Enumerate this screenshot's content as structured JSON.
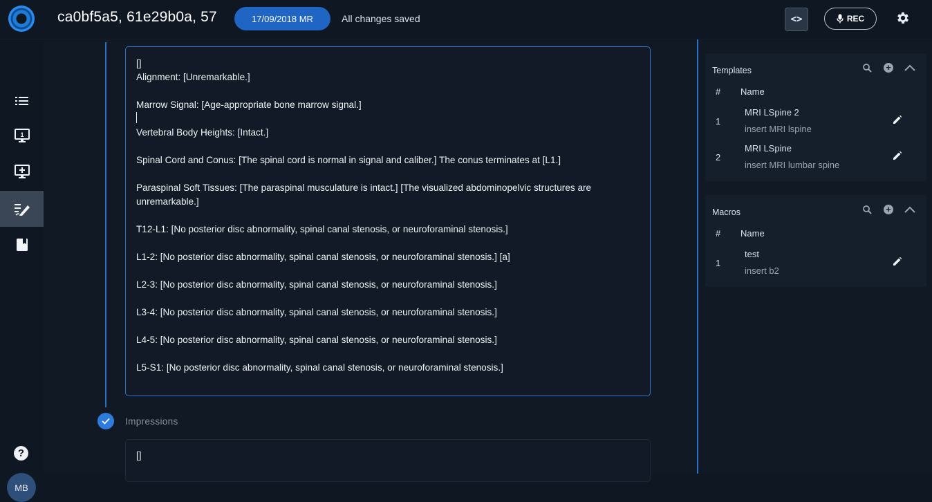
{
  "header": {
    "title": "ca0bf5a5, 61e29b0a, 57",
    "date_badge": "17/09/2018 MR",
    "save_status": "All changes saved",
    "code_toggle": "<>",
    "rec_label": "REC"
  },
  "sidebar": {
    "items": [
      {
        "icon": "list-icon"
      },
      {
        "icon": "monitor-one-icon",
        "badge": "1"
      },
      {
        "icon": "monitor-add-icon"
      },
      {
        "icon": "edit-report-icon",
        "active": true
      },
      {
        "icon": "book-icon"
      }
    ],
    "help": "?",
    "avatar_initials": "MB"
  },
  "editor": {
    "findings_text": "[]\nAlignment: [Unremarkable.]\n\nMarrow Signal: [Age-appropriate bone marrow signal.]\n\nVertebral Body Heights: [Intact.]\n\nSpinal Cord and Conus: [The spinal cord is normal in signal and caliber.] The conus terminates at [L1.]\n\nParaspinal Soft Tissues: [The paraspinal musculature is intact.] [The visualized abdominopelvic structures are unremarkable.]\n\nT12-L1: [No posterior disc abnormality, spinal canal stenosis, or neuroforaminal stenosis.]\n\nL1-2: [No posterior disc abnormality, spinal canal stenosis, or neuroforaminal stenosis.] [a]\n\nL2-3: [No posterior disc abnormality, spinal canal stenosis, or neuroforaminal stenosis.]\n\nL3-4: [No posterior disc abnormality, spinal canal stenosis, or neuroforaminal stenosis.]\n\nL4-5: [No posterior disc abnormality, spinal canal stenosis, or neuroforaminal stenosis.]\n\nL5-S1: [No posterior disc abnormality, spinal canal stenosis, or neuroforaminal stenosis.]",
    "impressions_label": "Impressions",
    "impressions_text": "[]"
  },
  "templates": {
    "title": "Templates",
    "col_num": "#",
    "col_name": "Name",
    "rows": [
      {
        "num": "1",
        "name": "MRI LSpine 2",
        "trigger": "insert MRI lspine"
      },
      {
        "num": "2",
        "name": "MRI LSpine",
        "trigger": "insert MRI lumbar spine"
      }
    ]
  },
  "macros": {
    "title": "Macros",
    "col_num": "#",
    "col_name": "Name",
    "rows": [
      {
        "num": "1",
        "name": "test",
        "trigger": "insert b2"
      }
    ]
  },
  "colors": {
    "accent": "#2d6fc9",
    "badge": "#2065c4",
    "background": "#0f1722"
  }
}
